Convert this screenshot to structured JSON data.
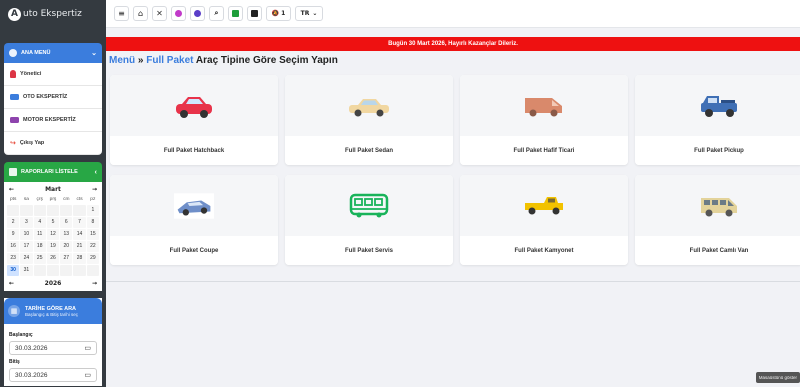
{
  "brand": {
    "logo_letter": "A",
    "name": "uto Ekspertiz"
  },
  "navbar": {
    "buttons": [
      {
        "name": "menu-toggle",
        "glyph": "≡"
      },
      {
        "name": "home",
        "glyph": "⌂"
      },
      {
        "name": "tools",
        "glyph": "✕"
      },
      {
        "name": "users",
        "glyph": "👥"
      },
      {
        "name": "user-add",
        "glyph": "👤"
      },
      {
        "name": "search",
        "glyph": "🔍"
      },
      {
        "name": "spreadsheet",
        "glyph": "■"
      },
      {
        "name": "calculator",
        "glyph": "▦"
      }
    ],
    "notification_count": "1",
    "language": "TR"
  },
  "sidebar": {
    "main_menu_label": "ANA MENÜ",
    "items": [
      {
        "label": "Yönetici",
        "color": "#dc3545"
      },
      {
        "label": "OTO EKSPERTİZ",
        "color": "#3b7ddd"
      },
      {
        "label": "MOTOR EKSPERTİZ",
        "color": "#8e44ad"
      },
      {
        "label": "Çıkış Yap",
        "color": "#e74c3c"
      }
    ],
    "reports_label": "RAPORLARI LİSTELE",
    "calendar": {
      "month": "Mart",
      "year": "2026",
      "prev": "←",
      "next": "→",
      "days": [
        "pts",
        "sa",
        "çrş",
        "prş",
        "cm",
        "cts",
        "pz"
      ],
      "cells": [
        "",
        "",
        "",
        "",
        "",
        "",
        "1",
        "2",
        "3",
        "4",
        "5",
        "6",
        "7",
        "8",
        "9",
        "10",
        "11",
        "12",
        "13",
        "14",
        "15",
        "16",
        "17",
        "18",
        "19",
        "20",
        "21",
        "22",
        "23",
        "24",
        "25",
        "26",
        "27",
        "28",
        "29",
        "30",
        "31",
        "",
        "",
        "",
        "",
        ""
      ],
      "today": "30"
    },
    "date_filter": {
      "title": "TARİHE GÖRE ARA",
      "subtitle": "Başlangıç & Bitiş tarihi seç",
      "start_label": "Başlangıç",
      "start_value": "30.03.2026",
      "end_label": "Bitiş",
      "end_value": "30.03.2026"
    }
  },
  "announcement": "Bugün 30 Mart 2026, Hayırlı Kazançlar Dileriz.",
  "page_title": {
    "menu": "Menü",
    "sep": " » ",
    "package": "Full Paket",
    "rest": " Araç Tipine Göre Seçim Yapın"
  },
  "vehicles": [
    {
      "label": "Full Paket Hatchback",
      "icon": "hatchback-icon",
      "color": "#e8334a"
    },
    {
      "label": "Full Paket Sedan",
      "icon": "sedan-icon",
      "color": "#f1d7a1"
    },
    {
      "label": "Full Paket Hafif Ticari",
      "icon": "van-icon",
      "color": "#d9896b"
    },
    {
      "label": "Full Paket Pickup",
      "icon": "pickup-icon",
      "color": "#3f6fb5"
    },
    {
      "label": "Full Paket Coupe",
      "icon": "coupe-icon",
      "color": "#6f8fc9"
    },
    {
      "label": "Full Paket Servis",
      "icon": "bus-icon",
      "color": "#19b35a"
    },
    {
      "label": "Full Paket Kamyonet",
      "icon": "truck-icon",
      "color": "#f2c200"
    },
    {
      "label": "Full Paket Camlı Van",
      "icon": "glass-van-icon",
      "color": "#e3d39b"
    }
  ],
  "tooltip": "Masaüstünü göster"
}
